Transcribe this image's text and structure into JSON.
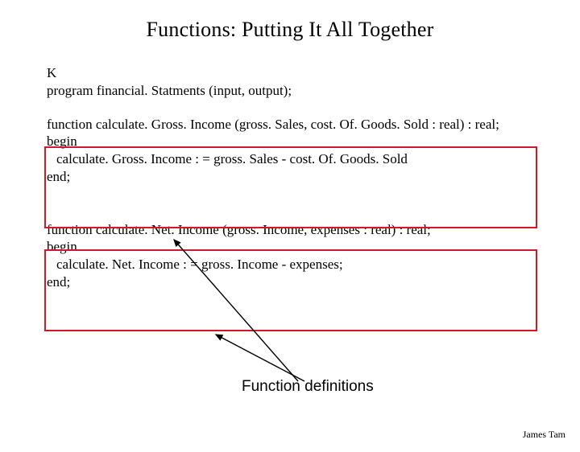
{
  "title": "Functions: Putting It All Together",
  "intro": {
    "line1": "K",
    "line2": "program financial. Statments (input, output);"
  },
  "func1": {
    "decl": "function calculate. Gross. Income (gross. Sales, cost. Of. Goods. Sold : real) : real;",
    "begin": "begin",
    "body": "calculate. Gross. Income : = gross. Sales - cost. Of. Goods. Sold",
    "end": "end;"
  },
  "func2": {
    "decl": "function calculate. Net. Income (gross. Income, expenses : real) : real;",
    "begin": "begin",
    "body": "calculate. Net. Income : = gross. Income - expenses;",
    "end": "end;"
  },
  "caption": "Function definitions",
  "footer": "James Tam",
  "box_color": "#c42024"
}
